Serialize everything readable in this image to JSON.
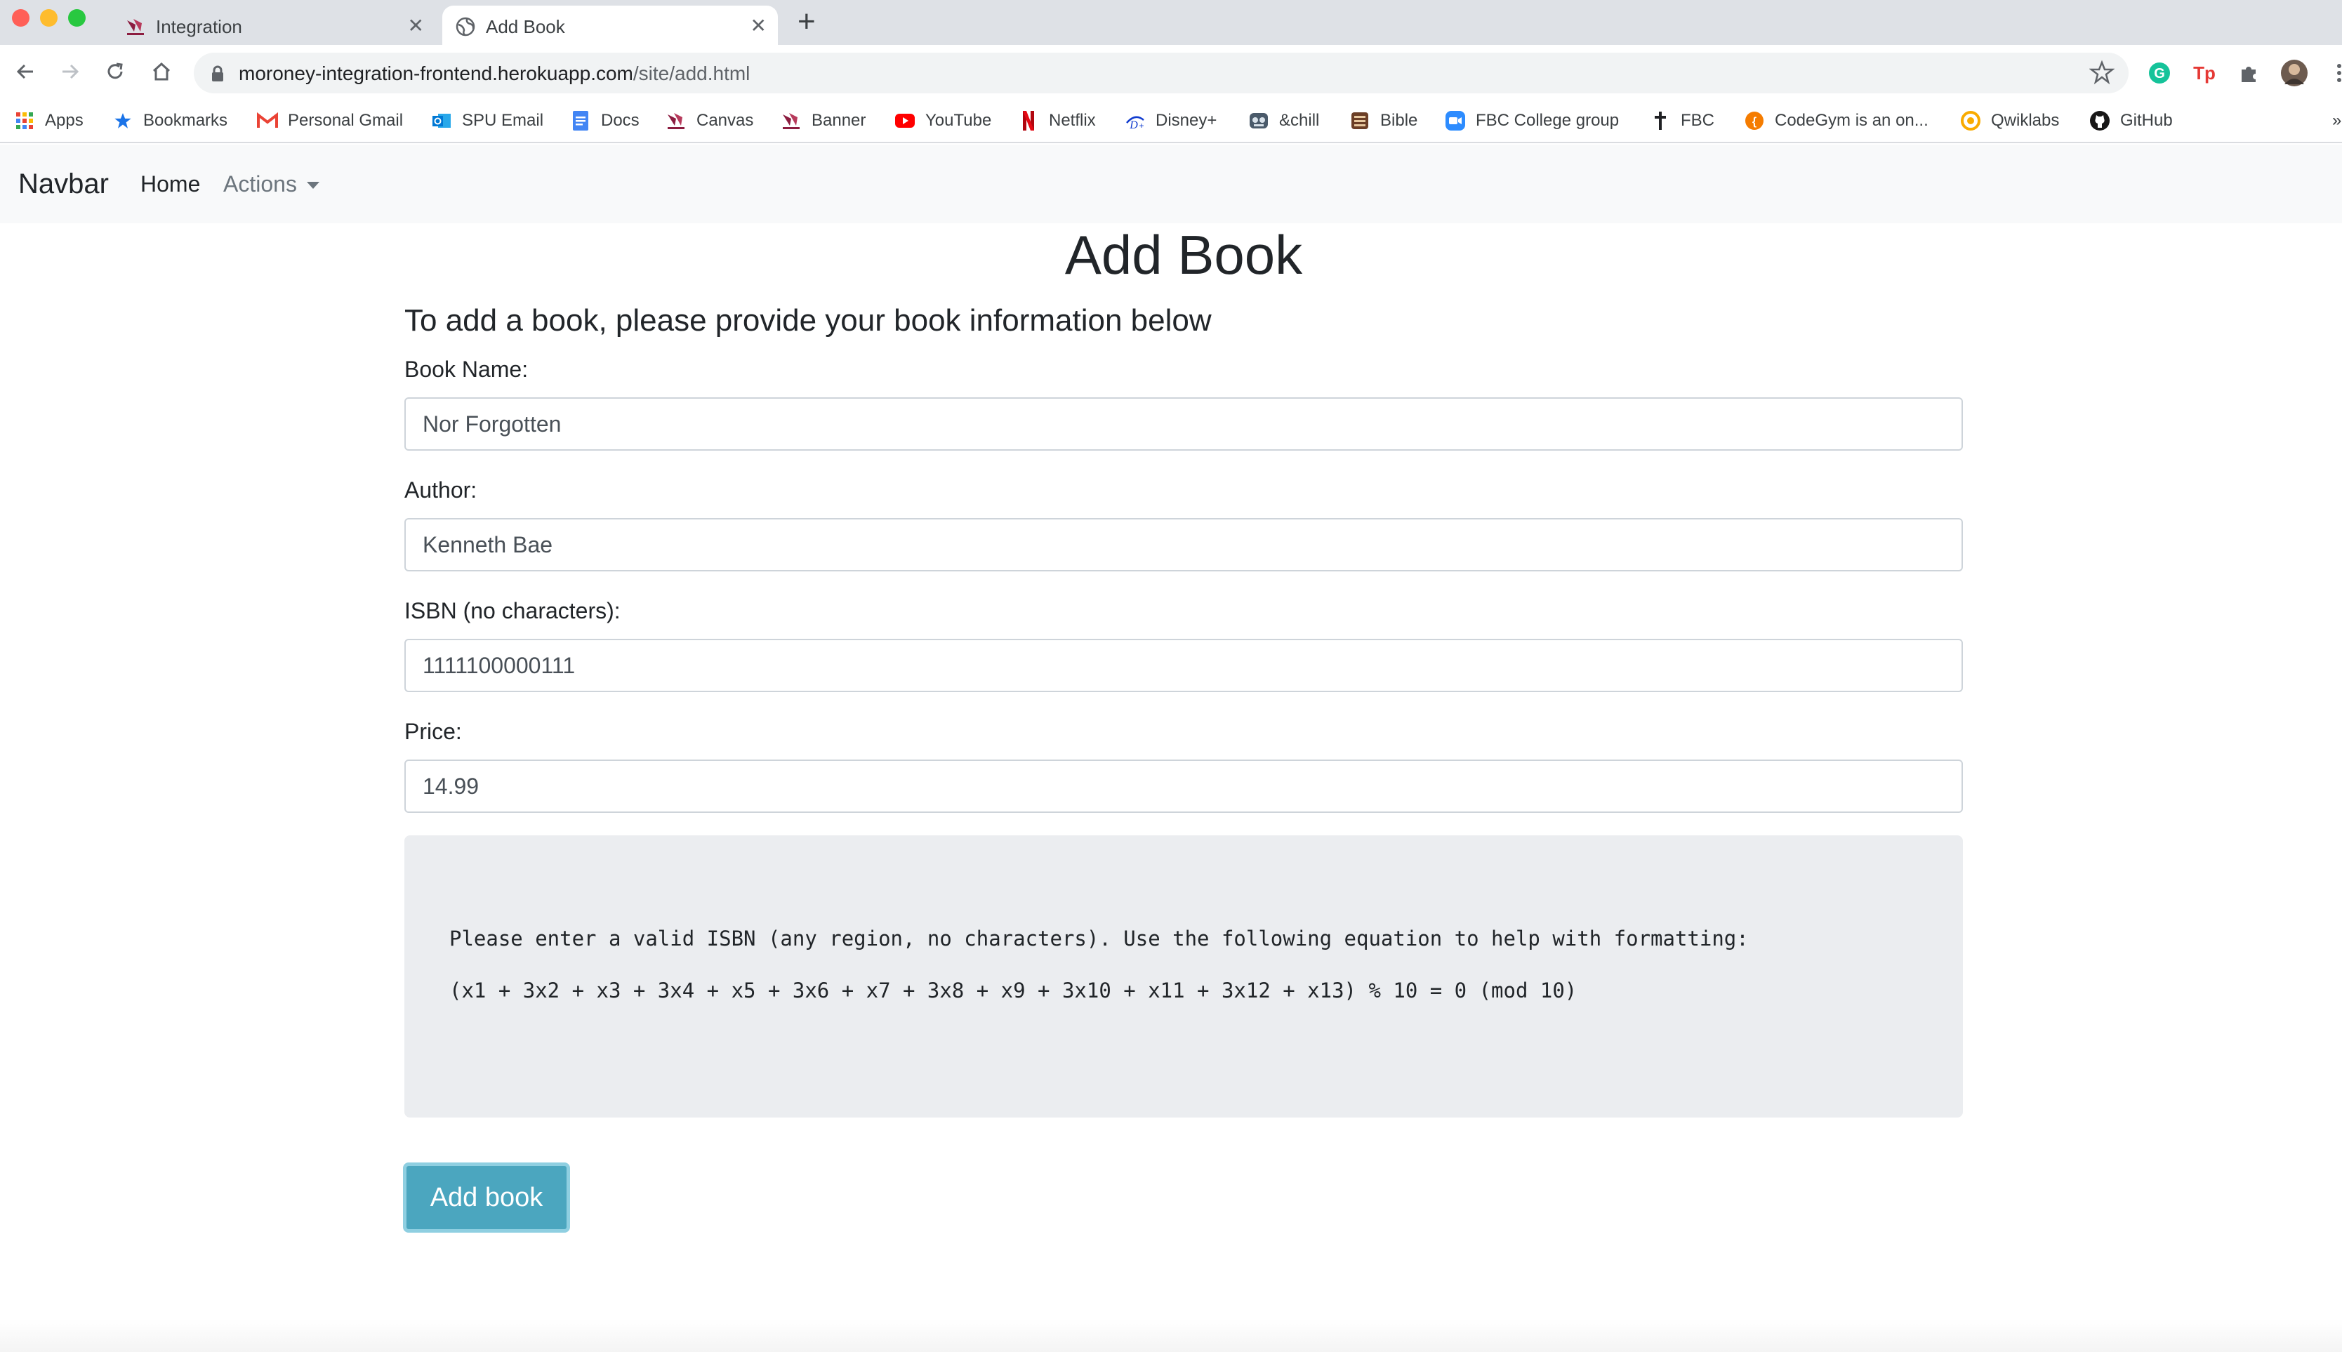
{
  "browser": {
    "tabs": [
      {
        "title": "Integration",
        "active": false
      },
      {
        "title": "Add Book",
        "active": true
      }
    ],
    "url_host": "moroney-integration-frontend.herokuapp.com",
    "url_path": "/site/add.html",
    "bookmarks": [
      {
        "label": "Apps",
        "icon": "apps-grid-icon",
        "color": "#ea4335"
      },
      {
        "label": "Bookmarks",
        "icon": "star-icon",
        "color": "#1a73e8"
      },
      {
        "label": "Personal Gmail",
        "icon": "gmail-icon",
        "color": "#ea4335"
      },
      {
        "label": "SPU Email",
        "icon": "outlook-icon",
        "color": "#0078d4"
      },
      {
        "label": "Docs",
        "icon": "docs-icon",
        "color": "#4285f4"
      },
      {
        "label": "Canvas",
        "icon": "canvas-icon",
        "color": "#8c1d40"
      },
      {
        "label": "Banner",
        "icon": "banner-icon",
        "color": "#8c1d40"
      },
      {
        "label": "YouTube",
        "icon": "youtube-icon",
        "color": "#ff0000"
      },
      {
        "label": "Netflix",
        "icon": "netflix-icon",
        "color": "#e50914"
      },
      {
        "label": "Disney+",
        "icon": "disney-icon",
        "color": "#113ccf"
      },
      {
        "label": "&chill",
        "icon": "chill-icon",
        "color": "#5f6368"
      },
      {
        "label": "Bible",
        "icon": "bible-icon",
        "color": "#6b3e26"
      },
      {
        "label": "FBC College group",
        "icon": "zoom-icon",
        "color": "#2d8cff"
      },
      {
        "label": "FBC",
        "icon": "cross-icon",
        "color": "#202124"
      },
      {
        "label": "CodeGym is an on...",
        "icon": "codegym-icon",
        "color": "#f57c00"
      },
      {
        "label": "Qwiklabs",
        "icon": "qwiklabs-icon",
        "color": "#f9ab00"
      },
      {
        "label": "GitHub",
        "icon": "github-icon",
        "color": "#181717"
      }
    ]
  },
  "navbar": {
    "brand": "Navbar",
    "home": "Home",
    "actions": "Actions"
  },
  "page": {
    "title": "Add Book",
    "subtitle": "To add a book, please provide your book information below"
  },
  "form": {
    "fields": [
      {
        "label": "Book Name:",
        "value": "Nor Forgotten"
      },
      {
        "label": "Author:",
        "value": "Kenneth Bae"
      },
      {
        "label": "ISBN (no characters):",
        "value": "1111100000111"
      },
      {
        "label": "Price:",
        "value": "14.99"
      }
    ],
    "hint_line_1": "Please enter a valid ISBN (any region, no characters). Use the following equation to help with formatting:",
    "hint_line_2": "(x1 + 3x2 + x3 + 3x4 + x5 + 3x6 + x7 + 3x8 + x9 + 3x10 + x11 + 3x12 + x13) % 10 = 0 (mod 10)",
    "submit_label": "Add book"
  },
  "colors": {
    "navbar_bg": "#f8f9fa",
    "submit_bg": "#4ba6bf",
    "hint_bg": "#ebedf0"
  }
}
